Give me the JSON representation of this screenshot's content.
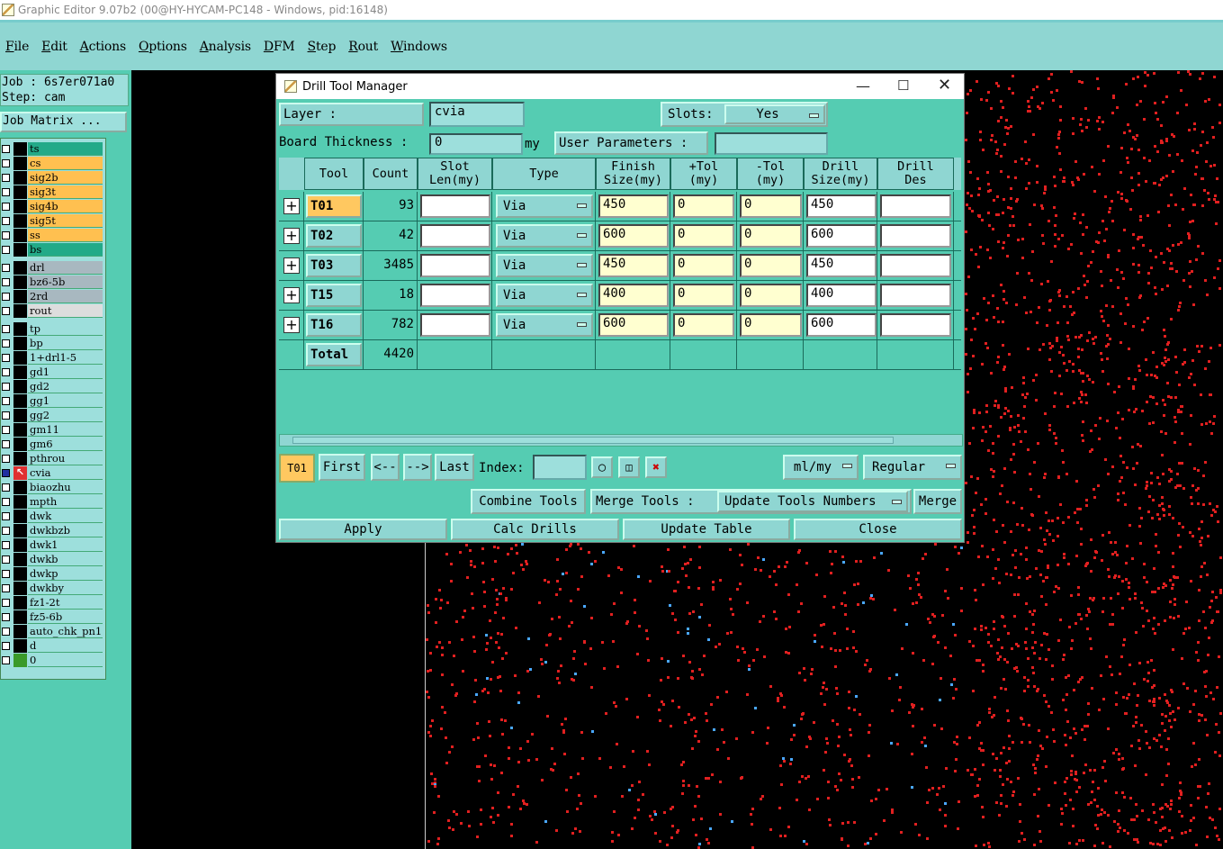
{
  "window_title": "Graphic Editor 9.07b2 (00@HY-HYCAM-PC148 - Windows, pid:16148)",
  "menu": [
    "File",
    "Edit",
    "Actions",
    "Options",
    "Analysis",
    "DFM",
    "Step",
    "Rout",
    "Windows"
  ],
  "job": {
    "job_line": "Job : 6s7er071a0",
    "step_line": "Step: cam",
    "matrix_button": "Job Matrix ..."
  },
  "layers": [
    {
      "name": "ts",
      "color": "#22aa88",
      "swatch": "#000"
    },
    {
      "name": "cs",
      "color": "#ffc050",
      "swatch": "#000"
    },
    {
      "name": "sig2b",
      "color": "#ffc050",
      "swatch": "#000"
    },
    {
      "name": "sig3t",
      "color": "#ffc050",
      "swatch": "#000"
    },
    {
      "name": "sig4b",
      "color": "#ffc050",
      "swatch": "#000"
    },
    {
      "name": "sig5t",
      "color": "#ffc050",
      "swatch": "#000"
    },
    {
      "name": "ss",
      "color": "#ffc050",
      "swatch": "#000"
    },
    {
      "name": "bs",
      "color": "#22aa88",
      "swatch": "#000"
    },
    {
      "name": "drl",
      "color": "#a8b8c0",
      "swatch": "#000"
    },
    {
      "name": "bz6-5b",
      "color": "#a8b8c0",
      "swatch": "#000"
    },
    {
      "name": "2rd",
      "color": "#a8b8c0",
      "swatch": "#000"
    },
    {
      "name": "rout",
      "color": "#dddddd",
      "swatch": "#000"
    },
    {
      "name": "tp",
      "color": "#9ddfdc",
      "swatch": "#000"
    },
    {
      "name": "bp",
      "color": "#9ddfdc",
      "swatch": "#000"
    },
    {
      "name": "1+drl1-5",
      "color": "#9ddfdc",
      "swatch": "#000"
    },
    {
      "name": "gd1",
      "color": "#9ddfdc",
      "swatch": "#000"
    },
    {
      "name": "gd2",
      "color": "#9ddfdc",
      "swatch": "#000"
    },
    {
      "name": "gg1",
      "color": "#9ddfdc",
      "swatch": "#000"
    },
    {
      "name": "gg2",
      "color": "#9ddfdc",
      "swatch": "#000"
    },
    {
      "name": "gm11",
      "color": "#9ddfdc",
      "swatch": "#000"
    },
    {
      "name": "gm6",
      "color": "#9ddfdc",
      "swatch": "#000"
    },
    {
      "name": "pthrou",
      "color": "#9ddfdc",
      "swatch": "#000"
    },
    {
      "name": "cvia",
      "color": "#9ddfdc",
      "swatch": "#e03030"
    },
    {
      "name": "biaozhu",
      "color": "#9ddfdc",
      "swatch": "#000"
    },
    {
      "name": "mpth",
      "color": "#9ddfdc",
      "swatch": "#000"
    },
    {
      "name": "dwk",
      "color": "#9ddfdc",
      "swatch": "#000"
    },
    {
      "name": "dwkbzb",
      "color": "#9ddfdc",
      "swatch": "#000"
    },
    {
      "name": "dwk1",
      "color": "#9ddfdc",
      "swatch": "#000"
    },
    {
      "name": "dwkb",
      "color": "#9ddfdc",
      "swatch": "#000"
    },
    {
      "name": "dwkp",
      "color": "#9ddfdc",
      "swatch": "#000"
    },
    {
      "name": "dwkby",
      "color": "#9ddfdc",
      "swatch": "#000"
    },
    {
      "name": "fz1-2t",
      "color": "#9ddfdc",
      "swatch": "#000"
    },
    {
      "name": "fz5-6b",
      "color": "#9ddfdc",
      "swatch": "#000"
    },
    {
      "name": "auto_chk_pn1",
      "color": "#9ddfdc",
      "swatch": "#000"
    },
    {
      "name": "d",
      "color": "#9ddfdc",
      "swatch": "#000"
    },
    {
      "name": "0",
      "color": "#9ddfdc",
      "swatch": "#3a9a2a"
    }
  ],
  "dialog": {
    "title": "Drill Tool Manager",
    "layer_label": "Layer           :",
    "layer_value": "cvia",
    "slots_label": "Slots:",
    "slots_value": "Yes",
    "thickness_label": "Board Thickness :",
    "thickness_value": "0",
    "thickness_unit": "my",
    "user_params_label": "User Parameters :",
    "user_params_value": "",
    "columns": [
      "Tool",
      "Count",
      "Slot\nLen(my)",
      "Type",
      "Finish\nSize(my)",
      "+Tol\n(my)",
      "-Tol\n(my)",
      "Drill\nSize(my)",
      "Drill\nDes"
    ],
    "rows": [
      {
        "tool": "T01",
        "count": "93",
        "slot": "",
        "type": "Via",
        "finish": "450",
        "ptol": "0",
        "mtol": "0",
        "drill": "450",
        "des": ""
      },
      {
        "tool": "T02",
        "count": "42",
        "slot": "",
        "type": "Via",
        "finish": "600",
        "ptol": "0",
        "mtol": "0",
        "drill": "600",
        "des": ""
      },
      {
        "tool": "T03",
        "count": "3485",
        "slot": "",
        "type": "Via",
        "finish": "450",
        "ptol": "0",
        "mtol": "0",
        "drill": "450",
        "des": ""
      },
      {
        "tool": "T15",
        "count": "18",
        "slot": "",
        "type": "Via",
        "finish": "400",
        "ptol": "0",
        "mtol": "0",
        "drill": "400",
        "des": ""
      },
      {
        "tool": "T16",
        "count": "782",
        "slot": "",
        "type": "Via",
        "finish": "600",
        "ptol": "0",
        "mtol": "0",
        "drill": "600",
        "des": ""
      }
    ],
    "total_label": "Total",
    "total_count": "4420",
    "current_tool": "T01",
    "nav": {
      "first": "First",
      "prev": "<--",
      "next": "-->",
      "last": "Last",
      "index_label": "Index:",
      "index_value": ""
    },
    "units": "ml/my",
    "mode": "Regular",
    "combine": "Combine Tools",
    "merge_label": "Merge Tools :",
    "merge_option": "Update Tools Numbers",
    "merge": "Merge",
    "apply": "Apply",
    "calc": "Calc Drills",
    "update": "Update Table",
    "close": "Close"
  }
}
